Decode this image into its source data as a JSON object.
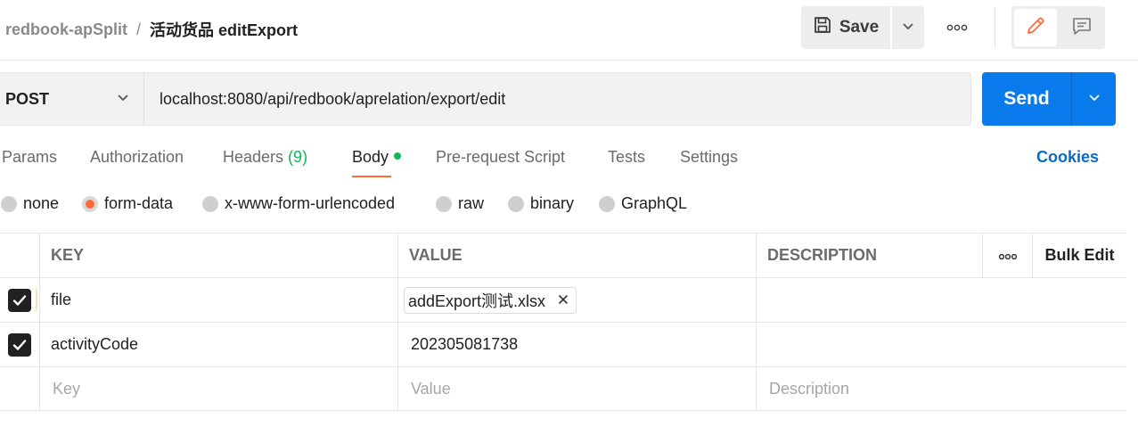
{
  "header": {
    "collection": "redbook-apSplit",
    "separator": "/",
    "request_name": "活动货品 editExport",
    "save_label": "Save"
  },
  "request": {
    "method": "POST",
    "url": "localhost:8080/api/redbook/aprelation/export/edit",
    "send_label": "Send"
  },
  "tabs": [
    {
      "label": "Params"
    },
    {
      "label": "Authorization"
    },
    {
      "label": "Headers",
      "count": "(9)"
    },
    {
      "label": "Body",
      "active": true
    },
    {
      "label": "Pre-request Script"
    },
    {
      "label": "Tests"
    },
    {
      "label": "Settings"
    }
  ],
  "cookies_label": "Cookies",
  "body_types": [
    {
      "label": "none",
      "selected": false
    },
    {
      "label": "form-data",
      "selected": true
    },
    {
      "label": "x-www-form-urlencoded",
      "selected": false
    },
    {
      "label": "raw",
      "selected": false
    },
    {
      "label": "binary",
      "selected": false
    },
    {
      "label": "GraphQL",
      "selected": false
    }
  ],
  "table": {
    "headers": {
      "key": "KEY",
      "value": "VALUE",
      "description": "DESCRIPTION",
      "bulk_edit": "Bulk Edit"
    },
    "rows": [
      {
        "checked": true,
        "key": "file",
        "value": "addExport测试.xlsx",
        "value_type": "file",
        "description": ""
      },
      {
        "checked": true,
        "key": "activityCode",
        "value": "202305081738",
        "value_type": "text",
        "description": ""
      }
    ],
    "placeholders": {
      "key": "Key",
      "value": "Value",
      "description": "Description"
    }
  },
  "colors": {
    "accent_orange": "#ff6c37",
    "send_blue": "#097bed",
    "count_green": "#0cbb52",
    "cookies_blue": "#0b6ac7"
  }
}
